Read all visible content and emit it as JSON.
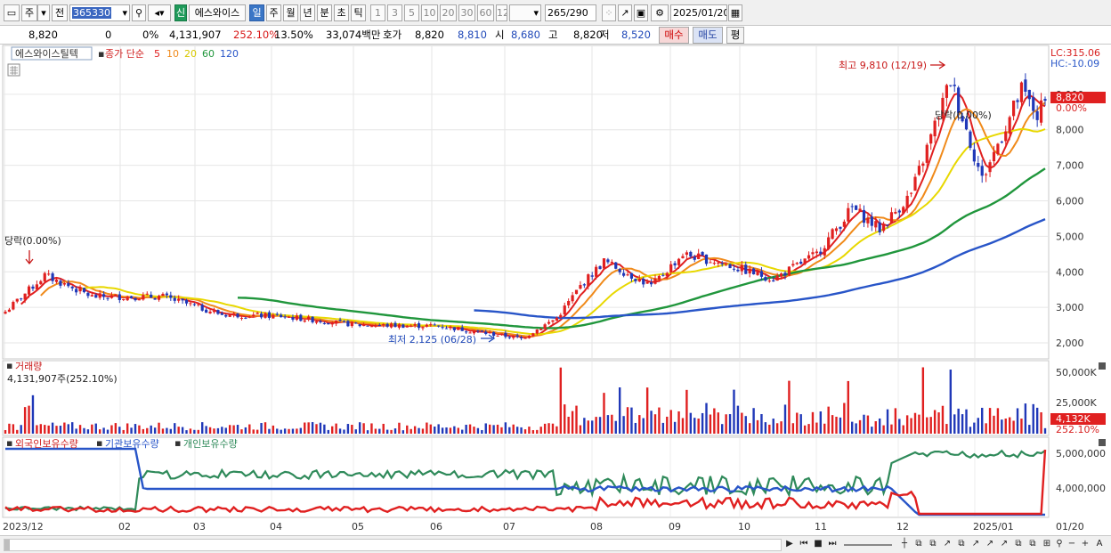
{
  "toolbar": {
    "period_type": "주",
    "prev_label": "전",
    "code": "365330",
    "stock_name": "에스와이스",
    "new_badge": "신",
    "tabs": [
      "일",
      "주",
      "월",
      "년",
      "분",
      "초",
      "틱"
    ],
    "intervals": [
      "1",
      "3",
      "5",
      "10",
      "20",
      "30",
      "60",
      "120"
    ],
    "count": "265",
    "count_total": "/290",
    "date": "2025/01/20"
  },
  "quote": {
    "price": "8,820",
    "change": "0",
    "change_pct": "0%",
    "volume": "4,131,907",
    "volume_ratio": "252.10%",
    "turnover": "13.50%",
    "amount": "33,074백만",
    "bid_label": "호가",
    "bid": "8,820",
    "bid2": "8,810",
    "open_label": "시",
    "open": "8,680",
    "high_label": "고",
    "high": "8,820",
    "low_label": "저",
    "low": "8,520",
    "buy_label": "매수",
    "sell_label": "매도",
    "flat_label": "평"
  },
  "chart_data": [
    {
      "type": "candlestick",
      "title": "에스와이스틸텍",
      "legend": {
        "label": "종가 단순",
        "items": [
          {
            "name": "5",
            "color": "#e02020"
          },
          {
            "name": "10",
            "color": "#f08a1a"
          },
          {
            "name": "20",
            "color": "#e8d800"
          },
          {
            "name": "60",
            "color": "#20963c"
          },
          {
            "name": "120",
            "color": "#2855c8"
          }
        ]
      },
      "y_ticks": [
        2000,
        3000,
        4000,
        5000,
        6000,
        7000,
        8000,
        9000
      ],
      "y_tick_labels": [
        "2,000",
        "3,000",
        "4,000",
        "5,000",
        "6,000",
        "7,000",
        "8,000",
        "9,000"
      ],
      "ylim": [
        1600,
        10200
      ],
      "x_labels": [
        "2023/12",
        "02",
        "03",
        "04",
        "05",
        "06",
        "07",
        "08",
        "09",
        "10",
        "11",
        "12",
        "2025/01",
        "01/20"
      ],
      "right_info": {
        "lc": "LC:315.06",
        "hc": "HC:-10.09"
      },
      "current_price_label": "8,820",
      "current_pct_label": "0.00%",
      "annotations": {
        "high": "최고 9,810 (12/19)",
        "low": "최저 2,125 (06/28)",
        "left_note": "당락(0.00%)",
        "right_note": "당락(0.00%)"
      },
      "series_values": {
        "first_close": 2880,
        "last_close": 8820,
        "high": 9810,
        "low": 2125
      }
    },
    {
      "type": "bar",
      "title": "거래량",
      "current_label": "4,131,907주(252.10%)",
      "y_tick_labels": [
        "50,000K",
        "25,000K"
      ],
      "current_value_label": "4,132K",
      "current_pct_label": "252.10%"
    },
    {
      "type": "line",
      "series": [
        {
          "name": "외국인보유수량",
          "color": "#e02020"
        },
        {
          "name": "기관보유수량",
          "color": "#2855c8"
        },
        {
          "name": "개인보유수량",
          "color": "#2f8a5a"
        }
      ],
      "y_tick_labels": [
        "5,000,000",
        "4,000,000"
      ]
    }
  ],
  "scroll": {
    "buttons": [
      "▶",
      "⏮",
      "■",
      "⏭"
    ],
    "zoom_labels": [
      "−",
      "+",
      "A"
    ]
  }
}
